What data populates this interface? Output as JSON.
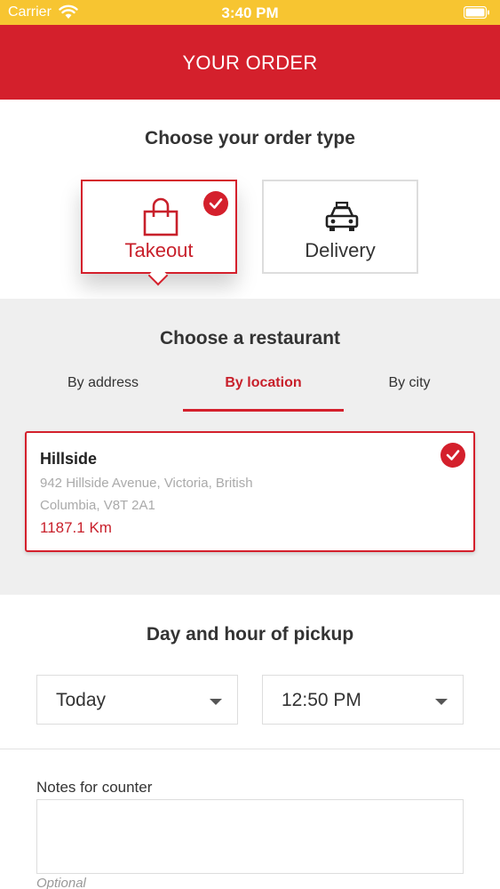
{
  "status_bar": {
    "carrier": "Carrier",
    "time": "3:40 PM"
  },
  "header": {
    "title": "YOUR ORDER"
  },
  "order_type": {
    "title": "Choose your order type",
    "options": [
      {
        "label": "Takeout",
        "icon": "shopping-bag-icon",
        "selected": true
      },
      {
        "label": "Delivery",
        "icon": "car-icon",
        "selected": false
      }
    ]
  },
  "restaurant": {
    "title": "Choose a restaurant",
    "tabs": [
      {
        "label": "By address",
        "active": false
      },
      {
        "label": "By location",
        "active": true
      },
      {
        "label": "By city",
        "active": false
      }
    ],
    "selected": {
      "name": "Hillside",
      "address": "942 Hillside Avenue, Victoria, British Columbia, V8T 2A1",
      "distance": "1187.1 Km"
    }
  },
  "pickup": {
    "title": "Day and hour of pickup",
    "day": "Today",
    "time": "12:50 PM"
  },
  "notes": {
    "label": "Notes for counter",
    "value": "",
    "hint": "Optional"
  },
  "colors": {
    "accent": "#d4202c",
    "status_bar": "#f7c531",
    "section_bg": "#efefef"
  }
}
